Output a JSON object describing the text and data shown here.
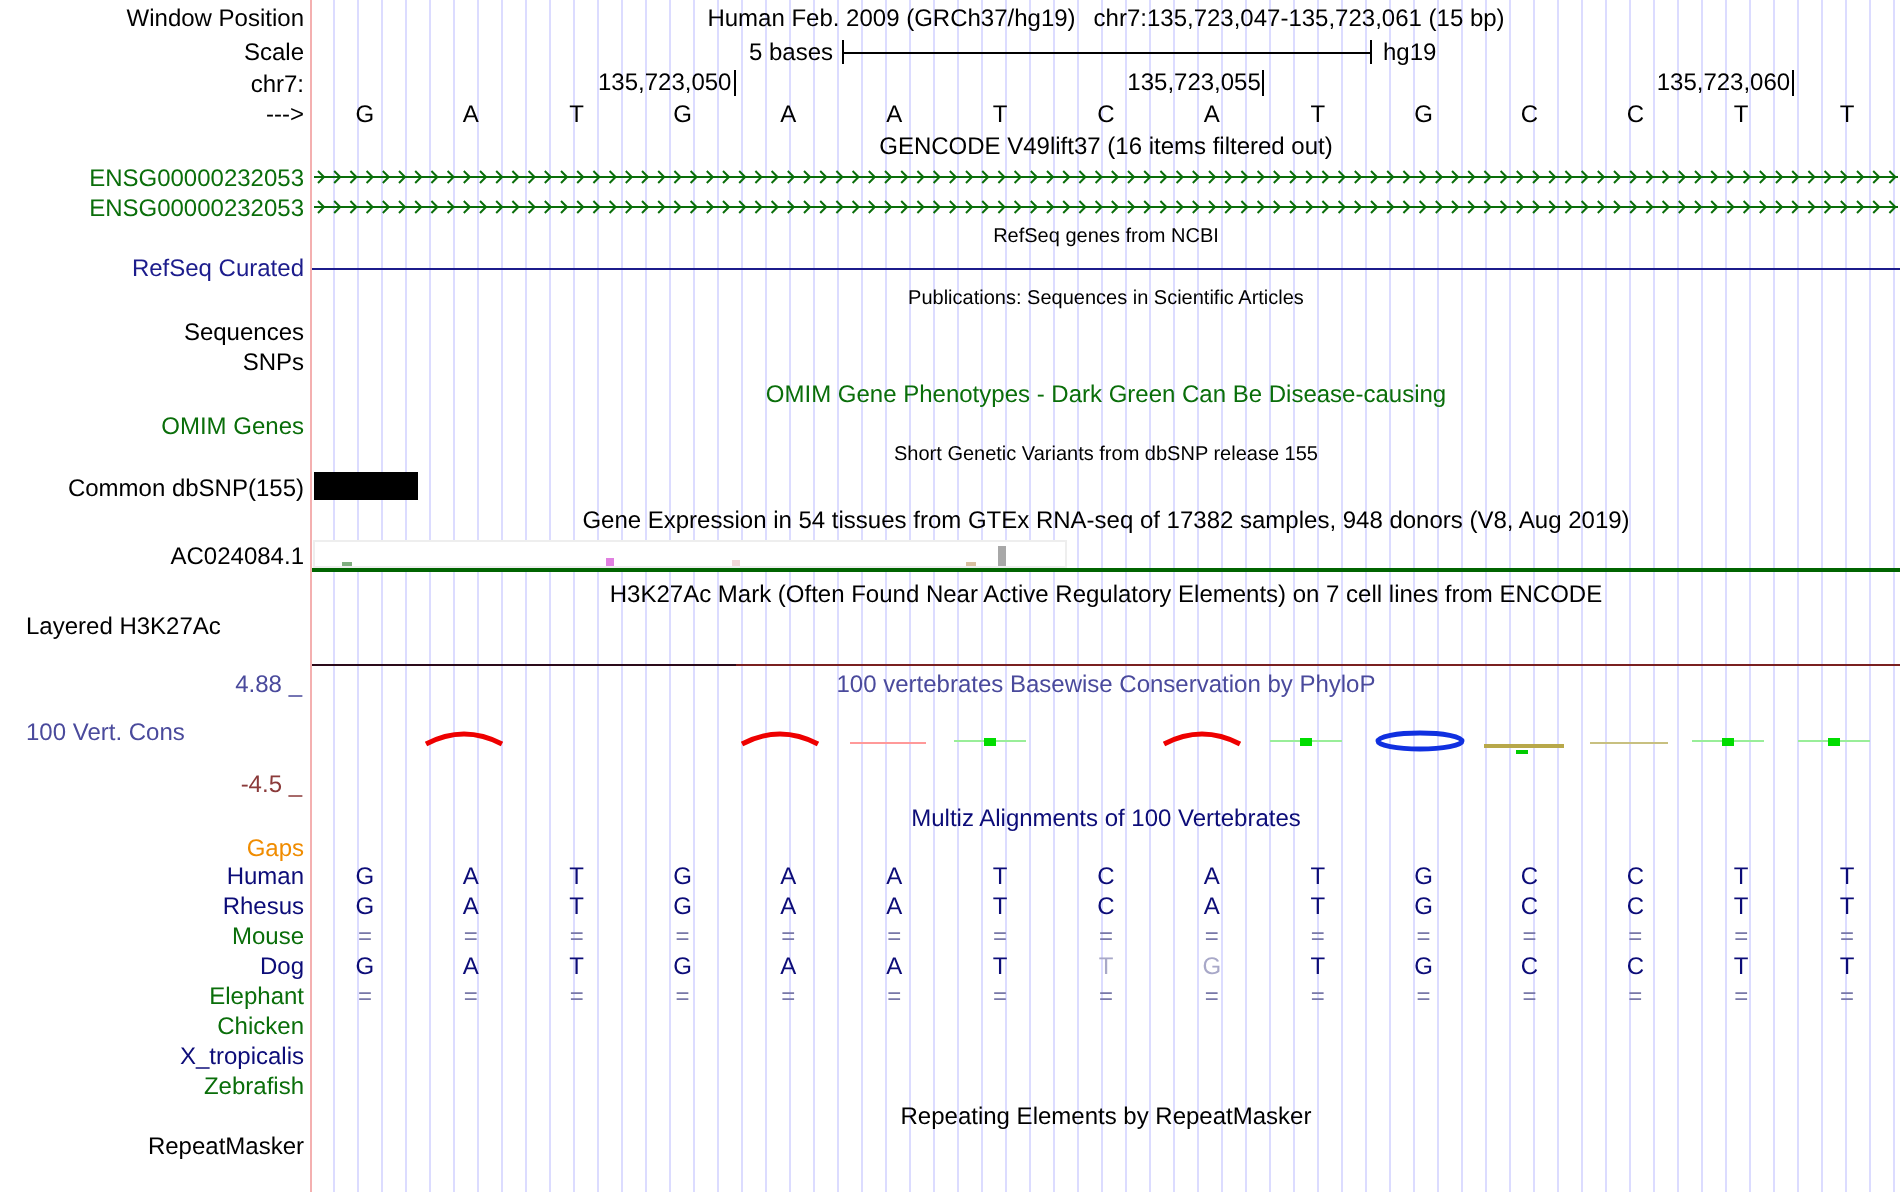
{
  "rows": [
    {
      "kind": "position",
      "label": "Window Position",
      "assembly": "Human Feb. 2009 (GRCh37/hg19)",
      "position": "chr7:135,723,047-135,723,061 (15 bp)"
    },
    {
      "kind": "scale",
      "label": "Scale",
      "scale_text": "5 bases",
      "assembly": "hg19"
    },
    {
      "kind": "ruler",
      "label": "chr7:",
      "ticks": [
        "135,723,050",
        "135,723,055",
        "135,723,060"
      ]
    },
    {
      "kind": "bases",
      "label": "--->",
      "bases": [
        "G",
        "A",
        "T",
        "G",
        "A",
        "A",
        "T",
        "C",
        "A",
        "T",
        "G",
        "C",
        "C",
        "T",
        "T"
      ]
    },
    {
      "kind": "title",
      "text": "GENCODE V49lift37 (16 items filtered out)",
      "color": "#000000"
    },
    {
      "kind": "gene",
      "label": "ENSG00000232053",
      "color": "#0a6e0a"
    },
    {
      "kind": "gene",
      "label": "ENSG00000232053",
      "color": "#0a6e0a"
    },
    {
      "kind": "subtitle",
      "text": "RefSeq genes from NCBI",
      "color": "#000000"
    },
    {
      "kind": "line",
      "label": "RefSeq Curated",
      "color": "#1c1c8c"
    },
    {
      "kind": "subtitle",
      "text": "Publications: Sequences in Scientific Articles",
      "color": "#000000"
    },
    {
      "kind": "label",
      "label": "Sequences",
      "color": "#000000"
    },
    {
      "kind": "label",
      "label": "SNPs",
      "color": "#000000"
    },
    {
      "kind": "title",
      "text": "OMIM Gene Phenotypes - Dark Green Can Be Disease-causing",
      "color": "#0a6e0a"
    },
    {
      "kind": "label",
      "label": "OMIM Genes",
      "color": "#0a6e0a"
    },
    {
      "kind": "subtitle",
      "text": "Short Genetic Variants from dbSNP release 155",
      "color": "#000000"
    },
    {
      "kind": "snp",
      "label": "Common dbSNP(155)",
      "color": "#000000"
    },
    {
      "kind": "title",
      "text": "Gene Expression in 54 tissues from GTEx RNA-seq of 17382 samples, 948 donors (V8, Aug 2019)",
      "color": "#000000"
    },
    {
      "kind": "expression",
      "label": "AC024084.1",
      "color": "#000000"
    },
    {
      "kind": "title",
      "text": "H3K27Ac Mark (Often Found Near Active Regulatory Elements) on 7 cell lines from ENCODE",
      "color": "#000000"
    },
    {
      "kind": "layered",
      "label": "Layered H3K27Ac",
      "color": "#000000"
    },
    {
      "kind": "conservation",
      "upper_label": "4.88 _",
      "label": "100 Vert. Cons",
      "lower": {
        "text": "-4.5 _",
        "color": "#8b3a3a"
      },
      "title": "100 vertebrates Basewise Conservation by PhyloP",
      "color": "#4a4a9c"
    },
    {
      "kind": "title",
      "text": "Multiz Alignments of 100 Vertebrates",
      "color": "#0c0c78"
    },
    {
      "kind": "label",
      "label": "Gaps",
      "color": "#f08c00"
    },
    {
      "kind": "species",
      "label": "Human",
      "color": "#0c0c78",
      "bases": [
        "G",
        "A",
        "T",
        "G",
        "A",
        "A",
        "T",
        "C",
        "A",
        "T",
        "G",
        "C",
        "C",
        "T",
        "T"
      ]
    },
    {
      "kind": "species",
      "label": "Rhesus",
      "color": "#0c0c78",
      "bases": [
        "G",
        "A",
        "T",
        "G",
        "A",
        "A",
        "T",
        "C",
        "A",
        "T",
        "G",
        "C",
        "C",
        "T",
        "T"
      ]
    },
    {
      "kind": "species",
      "label": "Mouse",
      "color": "#0a6e0a",
      "bases": [
        "=",
        "=",
        "=",
        "=",
        "=",
        "=",
        "=",
        "=",
        "=",
        "=",
        "=",
        "=",
        "=",
        "=",
        "="
      ]
    },
    {
      "kind": "species",
      "label": "Dog",
      "color": "#0c0c78",
      "cells": [
        {
          "text": "G",
          "faded": false
        },
        {
          "text": "A",
          "faded": false
        },
        {
          "text": "T",
          "faded": false
        },
        {
          "text": "G",
          "faded": false
        },
        {
          "text": "A",
          "faded": false
        },
        {
          "text": "A",
          "faded": false
        },
        {
          "text": "T",
          "faded": false
        },
        {
          "text": "T",
          "faded": true
        },
        {
          "text": "G",
          "faded": true
        },
        {
          "text": "T",
          "faded": false
        },
        {
          "text": "G",
          "faded": false
        },
        {
          "text": "C",
          "faded": false
        },
        {
          "text": "C",
          "faded": false
        },
        {
          "text": "T",
          "faded": false
        },
        {
          "text": "T",
          "faded": false
        }
      ]
    },
    {
      "kind": "species",
      "label": "Elephant",
      "color": "#0a6e0a",
      "bases": [
        "=",
        "=",
        "=",
        "=",
        "=",
        "=",
        "=",
        "=",
        "=",
        "=",
        "=",
        "=",
        "=",
        "=",
        "="
      ]
    },
    {
      "kind": "species",
      "label": "Chicken",
      "color": "#0a6e0a"
    },
    {
      "kind": "species",
      "label": "X_tropicalis",
      "color": "#0c0c78"
    },
    {
      "kind": "species",
      "label": "Zebrafish",
      "color": "#0a6e0a"
    },
    {
      "kind": "title",
      "text": "Repeating Elements by RepeatMasker",
      "color": "#000000"
    },
    {
      "kind": "label",
      "label": "RepeatMasker",
      "color": "#000000"
    }
  ]
}
